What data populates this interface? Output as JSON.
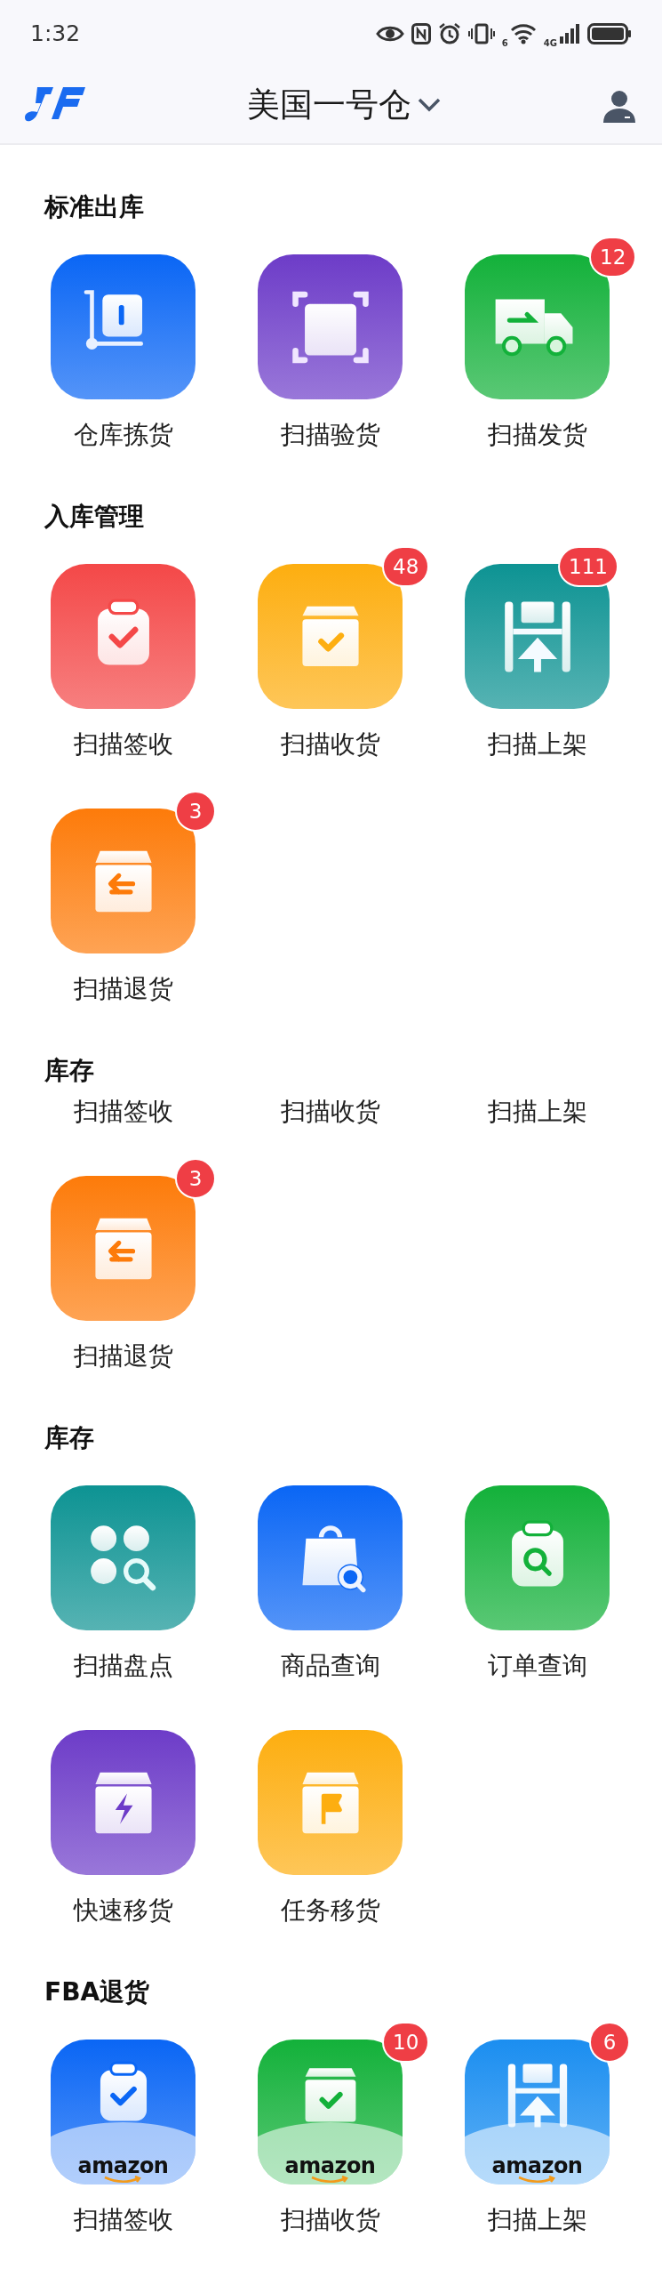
{
  "status_bar": {
    "time": "1:32",
    "wifi_label": "6",
    "signal_label": "4G"
  },
  "header": {
    "title": "美国一号仓"
  },
  "sections": [
    {
      "title": "标准出库",
      "items": [
        {
          "label": "仓库拣货",
          "kind": "tile",
          "color": "#0a66f5"
        },
        {
          "label": "扫描验货",
          "kind": "tile",
          "color": "#6d3cc8"
        },
        {
          "label": "扫描发货",
          "kind": "tile",
          "color": "#13b13a",
          "badge": "12"
        }
      ]
    },
    {
      "title": "入库管理",
      "items": [
        {
          "label": "扫描签收",
          "kind": "tile",
          "color": "#f44848"
        },
        {
          "label": "扫描收货",
          "kind": "tile",
          "color": "#fdae10",
          "badge": "48"
        },
        {
          "label": "扫描上架",
          "kind": "tile",
          "color": "#0d9393",
          "badge": "111"
        },
        {
          "label": "扫描退货",
          "kind": "tile",
          "color": "#fd7b0a",
          "badge": "3"
        }
      ]
    },
    {
      "title": "库存",
      "items": [
        {
          "label": "扫描签收",
          "kind": "label"
        },
        {
          "label": "扫描收货",
          "kind": "label"
        },
        {
          "label": "扫描上架",
          "kind": "label"
        },
        {
          "label": "扫描退货",
          "kind": "tile",
          "color": "#fd7b0a",
          "badge": "3"
        }
      ]
    },
    {
      "title": "库存",
      "items": [
        {
          "label": "扫描盘点",
          "kind": "tile",
          "color": "#0d9393"
        },
        {
          "label": "商品查询",
          "kind": "tile",
          "color": "#0a66f5"
        },
        {
          "label": "订单查询",
          "kind": "tile",
          "color": "#13b13a"
        },
        {
          "label": "快速移货",
          "kind": "tile",
          "color": "#6d3cc8"
        },
        {
          "label": "任务移货",
          "kind": "tile",
          "color": "#fdae10"
        }
      ]
    },
    {
      "title": "FBA退货",
      "items": [
        {
          "label": "扫描签收",
          "kind": "tile",
          "color": "#0a66f5",
          "logo_text": "amazon"
        },
        {
          "label": "扫描收货",
          "kind": "tile",
          "color": "#13b13a",
          "badge": "10",
          "logo_text": "amazon"
        },
        {
          "label": "扫描上架",
          "kind": "tile",
          "color": "#1b8ef0",
          "badge": "6",
          "logo_text": "amazon"
        }
      ]
    }
  ]
}
